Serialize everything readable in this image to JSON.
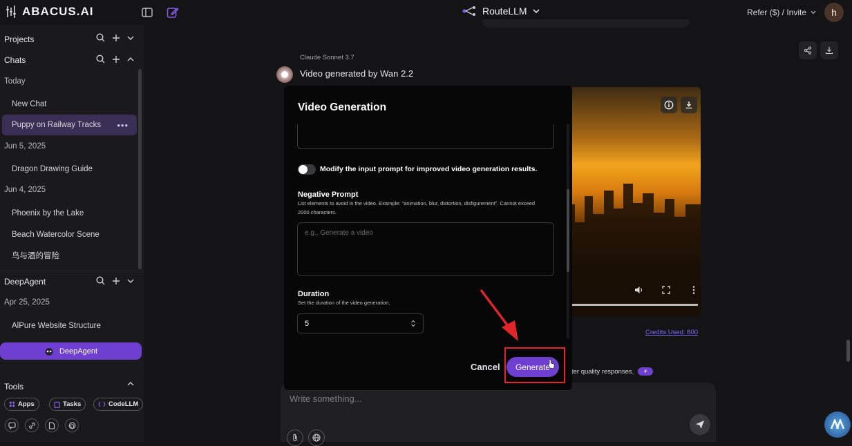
{
  "header": {
    "brand": "ABACUS.AI",
    "model_selector": "RouteLLM",
    "refer_invite": "Refer ($) / Invite",
    "avatar_initial": "h"
  },
  "sidebar": {
    "projects_label": "Projects",
    "chats_label": "Chats",
    "groups": [
      {
        "date": "Today",
        "items": [
          "New Chat",
          "Puppy on Railway Tracks"
        ]
      },
      {
        "date": "Jun 5, 2025",
        "items": [
          "Dragon Drawing Guide"
        ]
      },
      {
        "date": "Jun 4, 2025",
        "items": [
          "Phoenix by the Lake",
          "Beach Watercolor Scene",
          "鸟与酒的冒险"
        ]
      }
    ],
    "active_chat": "Puppy on Railway Tracks",
    "deepagent_label": "DeepAgent",
    "deepagent_group": {
      "date": "Apr 25, 2025",
      "items": [
        "AlPure Website Structure"
      ]
    },
    "deepagent_button": "DeepAgent",
    "tools_label": "Tools",
    "tools": [
      "Apps",
      "Tasks",
      "CodeLLM"
    ]
  },
  "chat": {
    "model_tag": "Claude Sonnet 3.7",
    "message": "Video generated by Wan 2.2",
    "credits": "Credits Used: 800",
    "quality_text": "ter quality responses.",
    "input_placeholder": "Write something..."
  },
  "modal": {
    "title": "Video Generation",
    "toggle_label": "Modify the input prompt for improved video generation results.",
    "toggle_on": false,
    "negative_label": "Negative Prompt",
    "negative_help": "List elements to avoid in the video. Example: \"animation, blur, distortion, disfigurement\". Cannot exceed 2000 characters.",
    "negative_placeholder": "e.g., Generate a video",
    "duration_label": "Duration",
    "duration_help": "Set the duration of the video generation.",
    "duration_value": "5",
    "cancel_label": "Cancel",
    "generate_label": "Generate"
  },
  "colors": {
    "accent": "#6f3fd1",
    "highlight": "#e0262b",
    "background": "#141416"
  }
}
